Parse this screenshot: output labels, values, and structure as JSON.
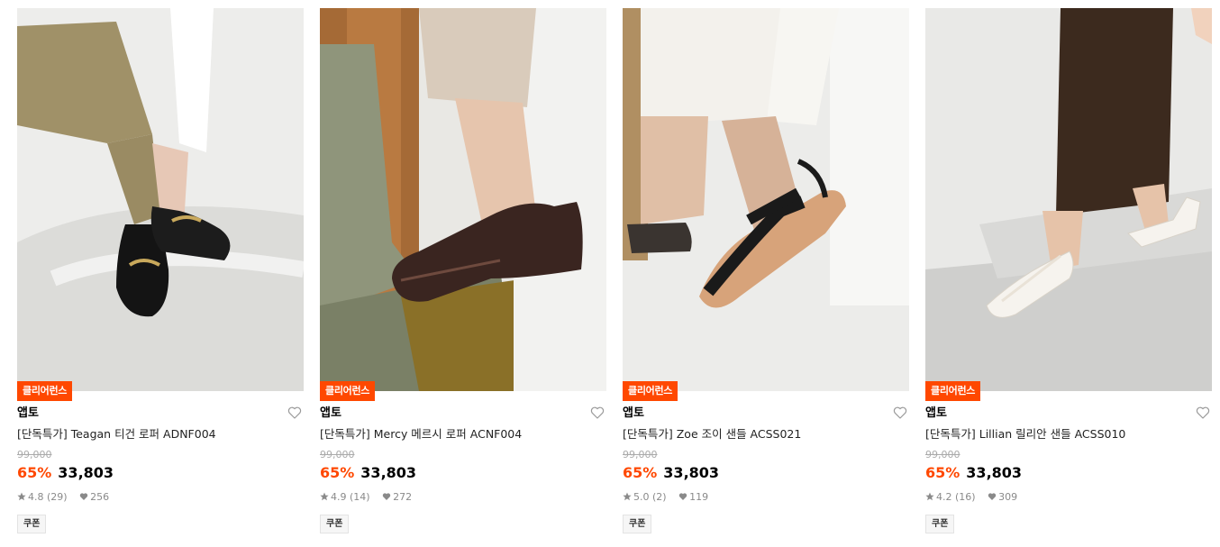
{
  "products": [
    {
      "badge": "클리어런스",
      "brand": "앱토",
      "title": "[단독특가] Teagan 티건 로퍼 ADNF004",
      "original_price": "99,000",
      "discount_rate": "65%",
      "price": "33,803",
      "rating": "4.8",
      "review_count": "(29)",
      "likes": "256",
      "coupon": "쿠폰"
    },
    {
      "badge": "클리어런스",
      "brand": "앱토",
      "title": "[단독특가] Mercy 메르시 로퍼 ACNF004",
      "original_price": "99,000",
      "discount_rate": "65%",
      "price": "33,803",
      "rating": "4.9",
      "review_count": "(14)",
      "likes": "272",
      "coupon": "쿠폰"
    },
    {
      "badge": "클리어런스",
      "brand": "앱토",
      "title": "[단독특가] Zoe 조이 샌들 ACSS021",
      "original_price": "99,000",
      "discount_rate": "65%",
      "price": "33,803",
      "rating": "5.0",
      "review_count": "(2)",
      "likes": "119",
      "coupon": "쿠폰"
    },
    {
      "badge": "클리어런스",
      "brand": "앱토",
      "title": "[단독특가] Lillian 릴리안 샌들 ACSS010",
      "original_price": "99,000",
      "discount_rate": "65%",
      "price": "33,803",
      "rating": "4.2",
      "review_count": "(16)",
      "likes": "309",
      "coupon": "쿠폰"
    }
  ],
  "colors": {
    "accent": "#ff4800",
    "badge_bg": "#ff4800",
    "muted_text": "#8a8a8a"
  }
}
